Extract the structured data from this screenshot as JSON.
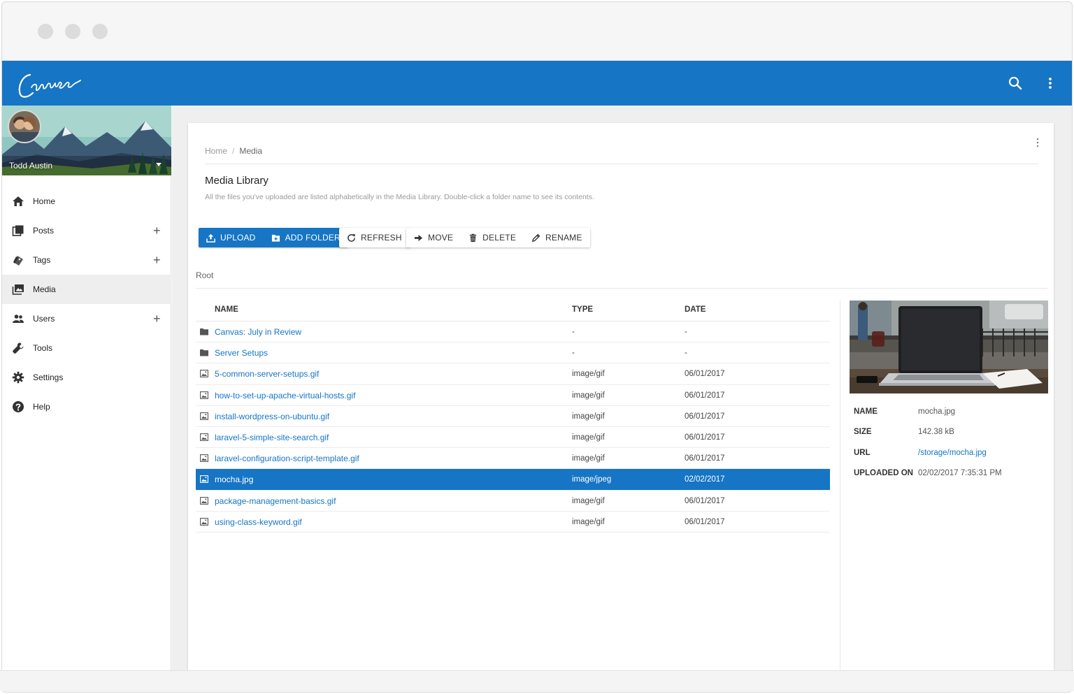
{
  "app": {
    "logo_text": "Canvas",
    "brand_color": "#1675c4"
  },
  "header": {
    "search_icon": "search-icon",
    "more_icon": "more-vert-icon"
  },
  "profile": {
    "name": "Todd Austin"
  },
  "sidebar": {
    "items": [
      {
        "label": "Home",
        "icon": "home-icon",
        "expandable": false,
        "active": false
      },
      {
        "label": "Posts",
        "icon": "posts-icon",
        "expandable": true,
        "active": false
      },
      {
        "label": "Tags",
        "icon": "tags-icon",
        "expandable": true,
        "active": false
      },
      {
        "label": "Media",
        "icon": "media-icon",
        "expandable": false,
        "active": true
      },
      {
        "label": "Users",
        "icon": "users-icon",
        "expandable": true,
        "active": false
      },
      {
        "label": "Tools",
        "icon": "wrench-icon",
        "expandable": false,
        "active": false
      },
      {
        "label": "Settings",
        "icon": "gear-icon",
        "expandable": false,
        "active": false
      },
      {
        "label": "Help",
        "icon": "help-icon",
        "expandable": false,
        "active": false
      }
    ],
    "plus_label": "+"
  },
  "breadcrumb": {
    "home": "Home",
    "separator": "/",
    "current": "Media"
  },
  "page": {
    "title": "Media Library",
    "description": "All the files you've uploaded are listed alphabetically in the Media Library. Double-click a folder name to see its contents."
  },
  "toolbar": {
    "upload": "UPLOAD",
    "add_folder": "ADD FOLDER",
    "refresh": "REFRESH",
    "move": "MOVE",
    "delete": "DELETE",
    "rename": "RENAME"
  },
  "folder": {
    "root_label": "Root"
  },
  "table": {
    "columns": [
      "NAME",
      "TYPE",
      "DATE"
    ],
    "rows": [
      {
        "name": "Canvas: July in Review",
        "type": "-",
        "date": "-",
        "kind": "folder",
        "selected": false
      },
      {
        "name": "Server Setups",
        "type": "-",
        "date": "-",
        "kind": "folder",
        "selected": false
      },
      {
        "name": "5-common-server-setups.gif",
        "type": "image/gif",
        "date": "06/01/2017",
        "kind": "image",
        "selected": false
      },
      {
        "name": "how-to-set-up-apache-virtual-hosts.gif",
        "type": "image/gif",
        "date": "06/01/2017",
        "kind": "image",
        "selected": false
      },
      {
        "name": "install-wordpress-on-ubuntu.gif",
        "type": "image/gif",
        "date": "06/01/2017",
        "kind": "image",
        "selected": false
      },
      {
        "name": "laravel-5-simple-site-search.gif",
        "type": "image/gif",
        "date": "06/01/2017",
        "kind": "image",
        "selected": false
      },
      {
        "name": "laravel-configuration-script-template.gif",
        "type": "image/gif",
        "date": "06/01/2017",
        "kind": "image",
        "selected": false
      },
      {
        "name": "mocha.jpg",
        "type": "image/jpeg",
        "date": "02/02/2017",
        "kind": "image",
        "selected": true
      },
      {
        "name": "package-management-basics.gif",
        "type": "image/gif",
        "date": "06/01/2017",
        "kind": "image",
        "selected": false
      },
      {
        "name": "using-class-keyword.gif",
        "type": "image/gif",
        "date": "06/01/2017",
        "kind": "image",
        "selected": false
      }
    ]
  },
  "details": {
    "items": [
      {
        "label": "NAME",
        "value": "mocha.jpg",
        "link": false
      },
      {
        "label": "SIZE",
        "value": "142.38 kB",
        "link": false
      },
      {
        "label": "URL",
        "value": "/storage/mocha.jpg",
        "link": true
      },
      {
        "label": "UPLOADED ON",
        "value": "02/02/2017 7:35:31 PM",
        "link": false
      }
    ]
  }
}
